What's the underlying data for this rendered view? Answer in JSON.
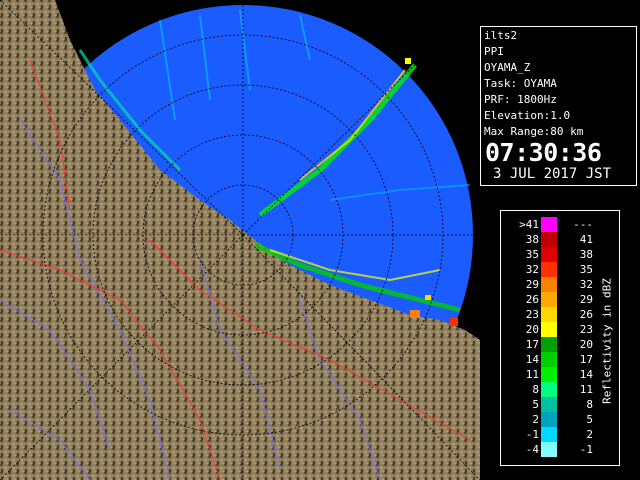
{
  "info": {
    "lines": [
      "ilts2",
      "PPI",
      "OYAMA_Z",
      "Task: OYAMA",
      "PRF: 1800Hz",
      "Elevation:1.0",
      "Max Range:80 km"
    ],
    "time": "07:30:36",
    "date": "3 JUL 2017 JST"
  },
  "legend": {
    "title": "Reflectivity in dBZ",
    "rows": [
      {
        "low": ">41",
        "high": "---",
        "color": "#ff00ff"
      },
      {
        "low": "38",
        "high": "41",
        "color": "#c00000"
      },
      {
        "low": "35",
        "high": "38",
        "color": "#e00000"
      },
      {
        "low": "32",
        "high": "35",
        "color": "#ff3000"
      },
      {
        "low": "29",
        "high": "32",
        "color": "#ff8000"
      },
      {
        "low": "26",
        "high": "29",
        "color": "#ffa800"
      },
      {
        "low": "23",
        "high": "26",
        "color": "#ffd800"
      },
      {
        "low": "20",
        "high": "23",
        "color": "#ffff00"
      },
      {
        "low": "17",
        "high": "20",
        "color": "#00a000"
      },
      {
        "low": "14",
        "high": "17",
        "color": "#00d000"
      },
      {
        "low": "11",
        "high": "14",
        "color": "#00f000"
      },
      {
        "low": "8",
        "high": "11",
        "color": "#00ff80"
      },
      {
        "low": "5",
        "high": "8",
        "color": "#00c0a0"
      },
      {
        "low": "2",
        "high": "5",
        "color": "#00a0c0"
      },
      {
        "low": "-1",
        "high": "2",
        "color": "#00d8ff"
      },
      {
        "low": "-4",
        "high": "-1",
        "color": "#80ffff"
      }
    ]
  },
  "colors": {
    "sea": "#1a5cff",
    "land": "#8a7a5a",
    "river": "#7070ff",
    "boundary": "#ff3030"
  }
}
